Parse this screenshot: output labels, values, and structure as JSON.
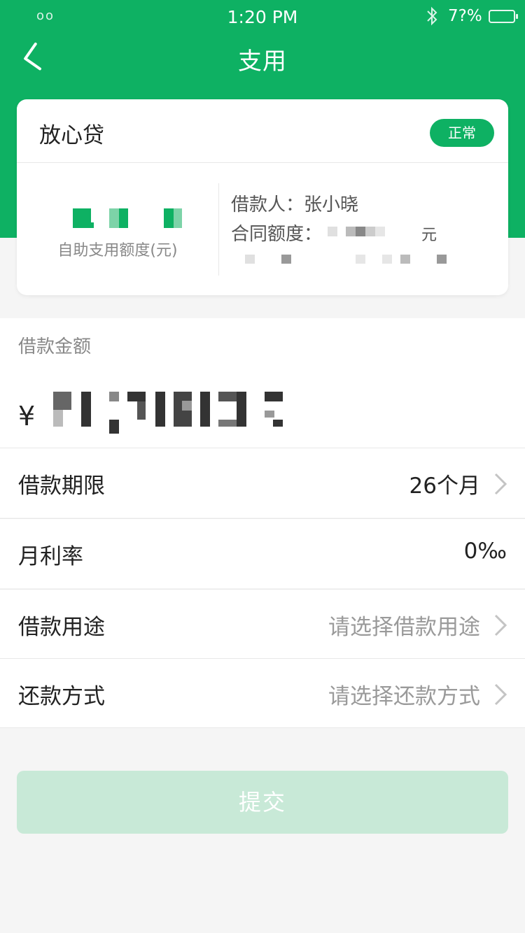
{
  "status_bar": {
    "carrier": "oo",
    "time": "1:20 PM",
    "battery_text": "7?%"
  },
  "nav": {
    "title": "支用",
    "back_icon": "chevron-left-icon"
  },
  "card": {
    "product_name": "放心贷",
    "status_badge": "正常",
    "quota_label": "自助支用额度(元)",
    "borrower_label": "借款人：",
    "borrower_name": "张小晓",
    "contract_label": "合同额度：",
    "contract_unit": "元"
  },
  "amount": {
    "label": "借款金额",
    "currency": "¥"
  },
  "rows": [
    {
      "label": "借款期限",
      "value": "26个月",
      "has_arrow": true,
      "placeholder": false
    },
    {
      "label": "月利率",
      "value": "0‰",
      "has_arrow": false,
      "placeholder": false
    },
    {
      "label": "借款用途",
      "value": "请选择借款用途",
      "has_arrow": true,
      "placeholder": true
    },
    {
      "label": "还款方式",
      "value": "请选择还款方式",
      "has_arrow": true,
      "placeholder": true
    }
  ],
  "submit": {
    "label": "提交"
  },
  "colors": {
    "brand_green": "#0eb163",
    "submit_disabled": "#c8e9d7",
    "background": "#f5f5f5"
  }
}
